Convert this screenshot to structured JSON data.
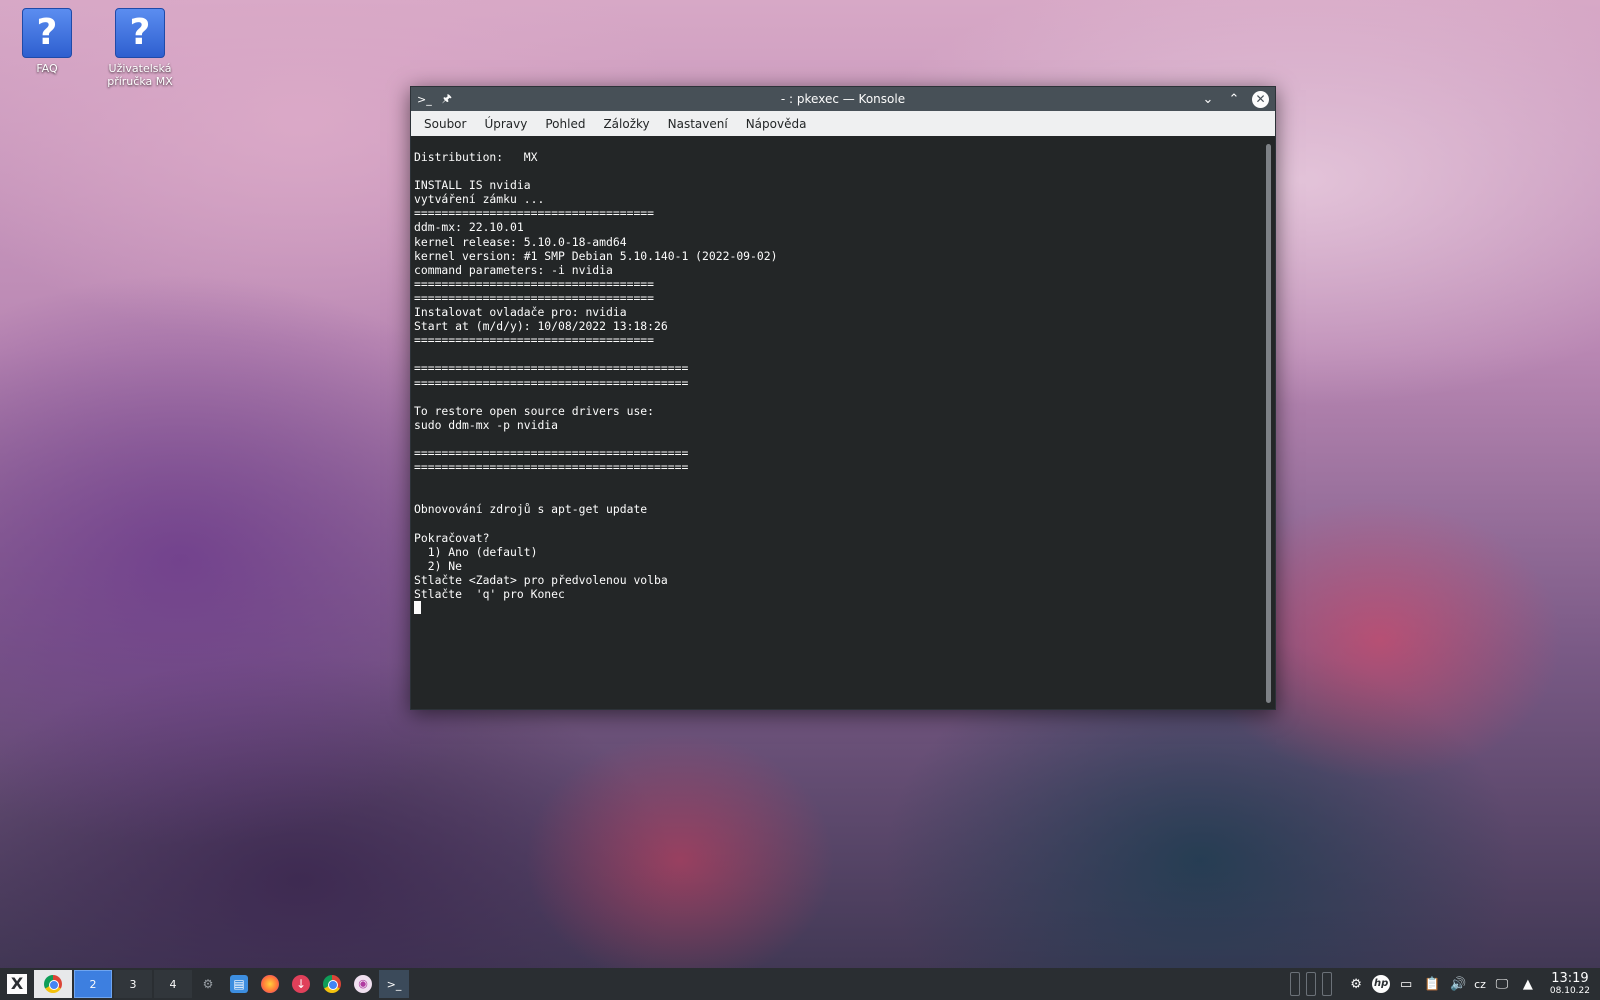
{
  "desktop": {
    "icons": [
      {
        "label": "FAQ",
        "glyph": "?"
      },
      {
        "label": "Uživatelská příručka MX",
        "glyph": "?"
      }
    ]
  },
  "window": {
    "title": "- : pkexec — Konsole",
    "menu": [
      "Soubor",
      "Úpravy",
      "Pohled",
      "Záložky",
      "Nastavení",
      "Nápověda"
    ]
  },
  "terminal": {
    "lines": [
      "Distribution:   MX",
      "",
      "INSTALL IS nvidia",
      "vytváření zámku ...",
      "===================================",
      "ddm-mx: 22.10.01",
      "kernel release: 5.10.0-18-amd64",
      "kernel version: #1 SMP Debian 5.10.140-1 (2022-09-02)",
      "command parameters: -i nvidia",
      "===================================",
      "===================================",
      "Instalovat ovladače pro: nvidia",
      "Start at (m/d/y): 10/08/2022 13:18:26",
      "===================================",
      "",
      "========================================",
      "========================================",
      "",
      "To restore open source drivers use:",
      "sudo ddm-mx -p nvidia",
      "",
      "========================================",
      "========================================",
      "",
      "",
      "Obnovování zdrojů s apt-get update",
      "",
      "Pokračovat?",
      "  1) Ano (default)",
      "  2) Ne",
      "Stlačte <Zadat> pro předvolenou volba",
      "Stlačte  'q' pro Konec"
    ]
  },
  "taskbar": {
    "desktops": [
      "2",
      "3",
      "4"
    ],
    "active_desktop": "2",
    "lang": "cz",
    "time": "13:19",
    "date": "08.10.22"
  }
}
